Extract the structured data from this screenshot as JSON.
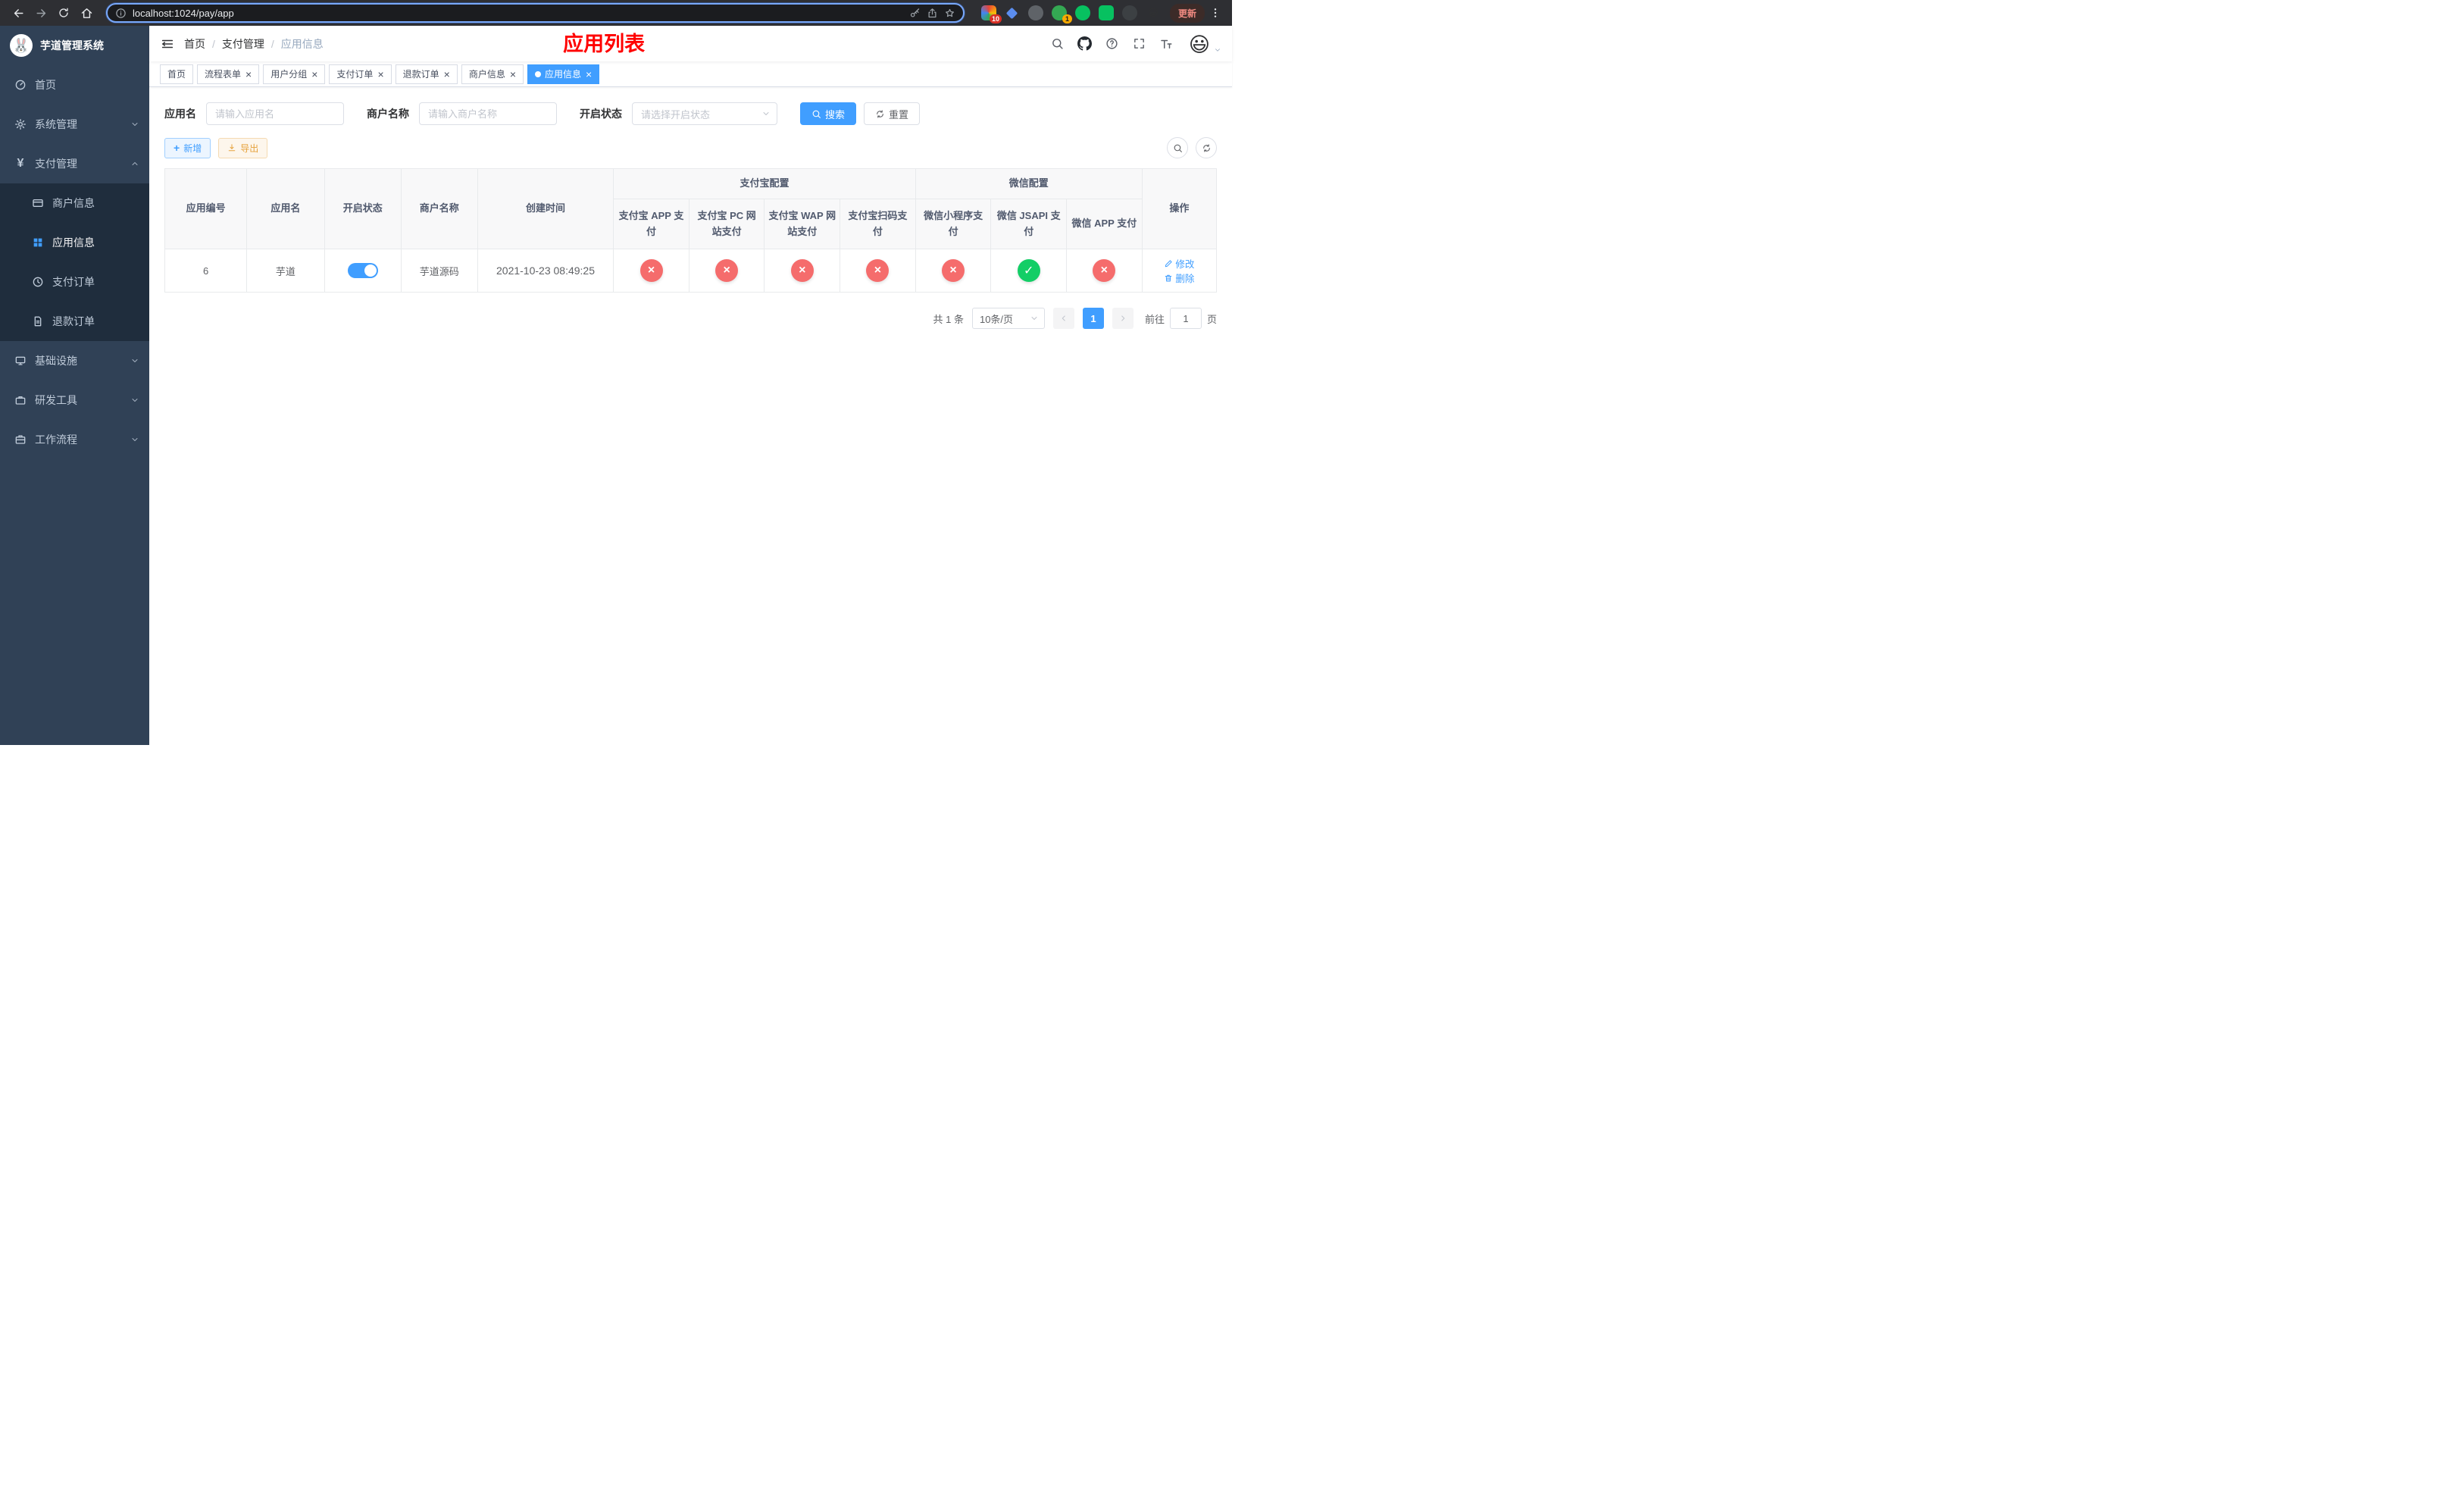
{
  "browser": {
    "url": "localhost:1024/pay/app",
    "update_label": "更新",
    "badge_grid": "10",
    "badge_green": "1"
  },
  "icons": {
    "logo_emoji": "🐰",
    "avatar_emoji": "😃",
    "yen": "¥",
    "close": "×",
    "plus": "+"
  },
  "sidebar": {
    "logo_title": "芋道管理系统",
    "items": [
      {
        "label": "首页"
      },
      {
        "label": "系统管理"
      },
      {
        "label": "支付管理"
      },
      {
        "label": "商户信息"
      },
      {
        "label": "应用信息"
      },
      {
        "label": "支付订单"
      },
      {
        "label": "退款订单"
      },
      {
        "label": "基础设施"
      },
      {
        "label": "研发工具"
      },
      {
        "label": "工作流程"
      }
    ]
  },
  "header": {
    "breadcrumb": [
      "首页",
      "支付管理",
      "应用信息"
    ],
    "banner": "应用列表"
  },
  "tabs": [
    {
      "label": "首页"
    },
    {
      "label": "流程表单"
    },
    {
      "label": "用户分组"
    },
    {
      "label": "支付订单"
    },
    {
      "label": "退款订单"
    },
    {
      "label": "商户信息"
    },
    {
      "label": "应用信息"
    }
  ],
  "filters": {
    "app_name_label": "应用名",
    "app_name_placeholder": "请输入应用名",
    "merchant_label": "商户名称",
    "merchant_placeholder": "请输入商户名称",
    "status_label": "开启状态",
    "status_placeholder": "请选择开启状态",
    "search_label": "搜索",
    "reset_label": "重置"
  },
  "toolbar": {
    "add_label": "新增",
    "export_label": "导出"
  },
  "table": {
    "group_alipay": "支付宝配置",
    "group_wechat": "微信配置",
    "columns": [
      "应用编号",
      "应用名",
      "开启状态",
      "商户名称",
      "创建时间",
      "支付宝 APP 支付",
      "支付宝 PC 网站支付",
      "支付宝 WAP 网站支付",
      "支付宝扫码支付",
      "微信小程序支付",
      "微信 JSAPI 支付",
      "微信 APP 支付",
      "操作"
    ],
    "rows": [
      {
        "id": "6",
        "name": "芋道",
        "status": "on",
        "merchant": "芋道源码",
        "created": "2021-10-23 08:49:25",
        "alipay_app": "no",
        "alipay_pc": "no",
        "alipay_wap": "no",
        "alipay_qr": "no",
        "wx_mini": "no",
        "wx_jsapi": "yes",
        "wx_app": "no",
        "edit_label": "修改",
        "delete_label": "删除"
      }
    ]
  },
  "pagination": {
    "total_text": "共 1 条",
    "page_size": "10条/页",
    "current_page": "1",
    "goto_prefix": "前往",
    "goto_value": "1",
    "goto_suffix": "页"
  },
  "colors": {
    "accent": "#409eff",
    "danger": "#f56c6c",
    "success": "#13ce66",
    "warning": "#e6a23c",
    "banner_red": "#ff0000",
    "sidebar_bg": "#304156",
    "submenu_bg": "#1f2d3d"
  }
}
